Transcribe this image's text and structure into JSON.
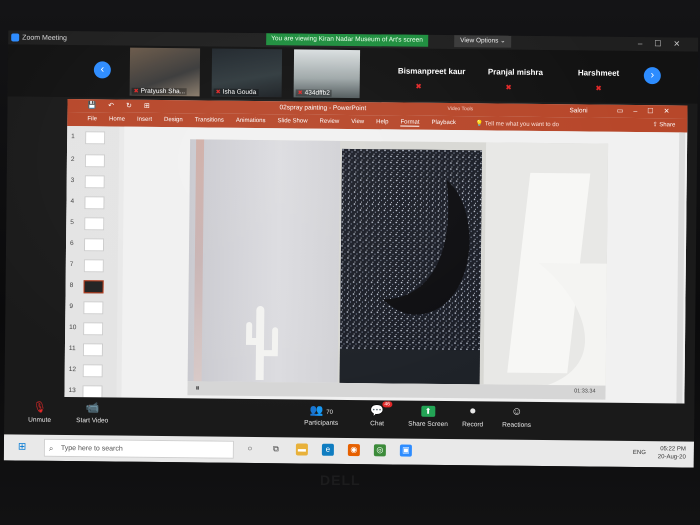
{
  "zoom": {
    "window_title": "Zoom Meeting",
    "viewing_banner": "You are viewing Kiran Nadar Museum of Art's screen",
    "view_options": "View Options ⌄",
    "participants_strip": [
      {
        "name": "Pratyush Sha..."
      },
      {
        "name": "Isha Gouda"
      },
      {
        "name": "434dffb2"
      }
    ],
    "name_only_tiles": [
      "Bismanpreet kaur",
      "Pranjal mishra",
      "Harshmeet"
    ],
    "toolbar": {
      "unmute": "Unmute",
      "start_video": "Start Video",
      "participants": "Participants",
      "participants_count": "70",
      "chat": "Chat",
      "chat_badge": "46",
      "share_screen": "Share Screen",
      "record": "Record",
      "reactions": "Reactions"
    }
  },
  "powerpoint": {
    "title": "02spray painting - PowerPoint",
    "video_tools": "Video Tools",
    "user": "Saloni",
    "tabs": [
      "File",
      "Home",
      "Insert",
      "Design",
      "Transitions",
      "Animations",
      "Slide Show",
      "Review",
      "View",
      "Help",
      "Format",
      "Playback"
    ],
    "tell_me": "Tell me what you want to do",
    "share": "Share",
    "slide_numbers": [
      "1",
      "2",
      "3",
      "4",
      "5",
      "6",
      "7",
      "8",
      "9",
      "10",
      "11",
      "12",
      "13"
    ],
    "selected_slide": "8",
    "video_time": "01:33.34"
  },
  "taskbar": {
    "search_placeholder": "Type here to search",
    "language": "ENG",
    "time": "05:22 PM",
    "date": "20-Aug-20"
  },
  "colors": {
    "ppt_red": "#b7472a",
    "zoom_blue": "#2d8cff",
    "zoom_green": "#1e8e3e",
    "mic_red": "#e02828"
  }
}
